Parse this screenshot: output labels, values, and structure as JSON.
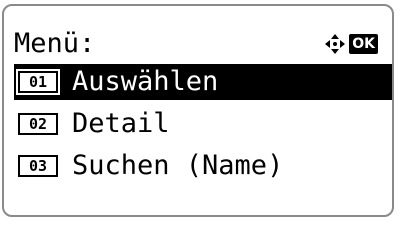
{
  "screen": {
    "title": "Menü:",
    "nav_icon": "four-way-arrow-icon",
    "ok_label": "OK"
  },
  "menu": {
    "items": [
      {
        "number": "01",
        "label": "Auswählen",
        "selected": true
      },
      {
        "number": "02",
        "label": "Detail",
        "selected": false
      },
      {
        "number": "03",
        "label": "Suchen (Name)",
        "selected": false
      }
    ]
  },
  "colors": {
    "highlight": "#000000",
    "background": "#ffffff",
    "border": "#8a8a8a"
  }
}
